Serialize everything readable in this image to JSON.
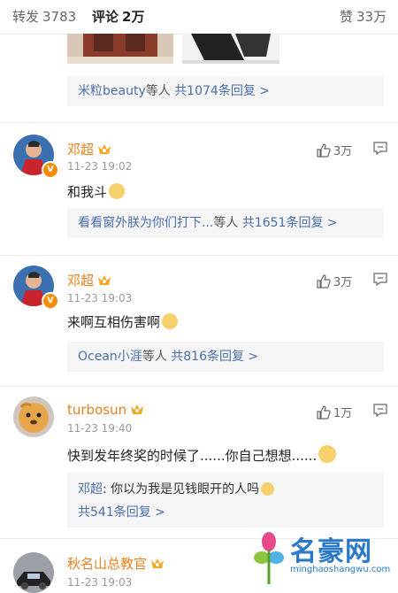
{
  "tabs": {
    "repost": {
      "label": "转发",
      "count": "3783"
    },
    "comments": {
      "label": "评论",
      "count": "2万"
    },
    "likes": {
      "label": "赞",
      "count": "33万"
    }
  },
  "top_reply": {
    "names": "米粒beauty",
    "suffix": "等人",
    "count_text": "共1074条回复 >"
  },
  "comments": [
    {
      "username": "邓超",
      "time": "11-23 19:02",
      "text": "和我斗",
      "likes": "3万",
      "replies": {
        "names": "看看窗外朕为你们打下...",
        "suffix": "等人",
        "count_text": "共1651条回复 >"
      }
    },
    {
      "username": "邓超",
      "time": "11-23 19:03",
      "text": "来啊互相伤害啊",
      "likes": "3万",
      "replies": {
        "names": "Ocean小涯",
        "suffix": "等人",
        "count_text": "共816条回复 >"
      }
    },
    {
      "username": "turbosun",
      "time": "11-23 19:40",
      "text": "快到发年终奖的时候了......你自己想想......",
      "likes": "1万",
      "sub_reply": {
        "author": "邓超",
        "text": ": 你以为我是见钱眼开的人吗",
        "count_text": "共541条回复 >"
      }
    },
    {
      "username": "秋名山总教官",
      "time": "11-23 19:03"
    }
  ],
  "watermark": {
    "title": "名豪网",
    "url": "minghaoshangwu.com"
  }
}
